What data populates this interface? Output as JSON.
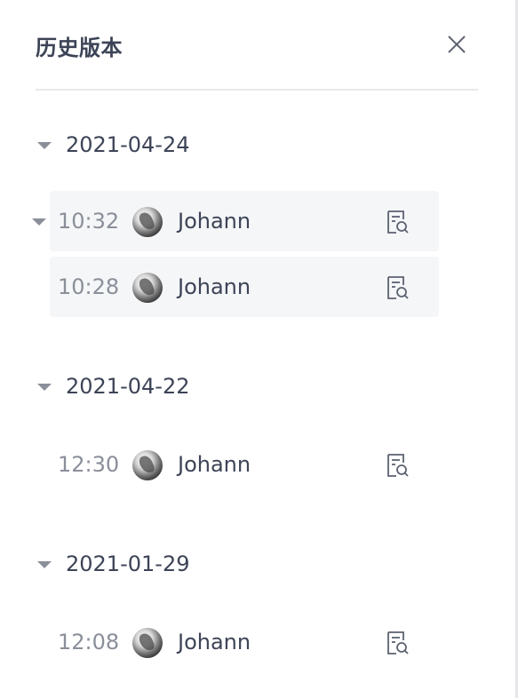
{
  "panel": {
    "title": "历史版本",
    "close_icon": "close-icon"
  },
  "groups": [
    {
      "date": "2021-04-24",
      "entries": [
        {
          "time": "10:32",
          "user": "Johann",
          "expandable": true,
          "highlighted": true
        },
        {
          "time": "10:28",
          "user": "Johann",
          "expandable": false,
          "highlighted": true
        }
      ]
    },
    {
      "date": "2021-04-22",
      "entries": [
        {
          "time": "12:30",
          "user": "Johann",
          "expandable": false,
          "highlighted": false
        }
      ]
    },
    {
      "date": "2021-01-29",
      "entries": [
        {
          "time": "12:08",
          "user": "Johann",
          "expandable": false,
          "highlighted": false
        }
      ]
    }
  ],
  "colors": {
    "text_primary": "#3d4457",
    "text_secondary": "#8a8f99",
    "highlight_bg": "#f5f6f8"
  }
}
